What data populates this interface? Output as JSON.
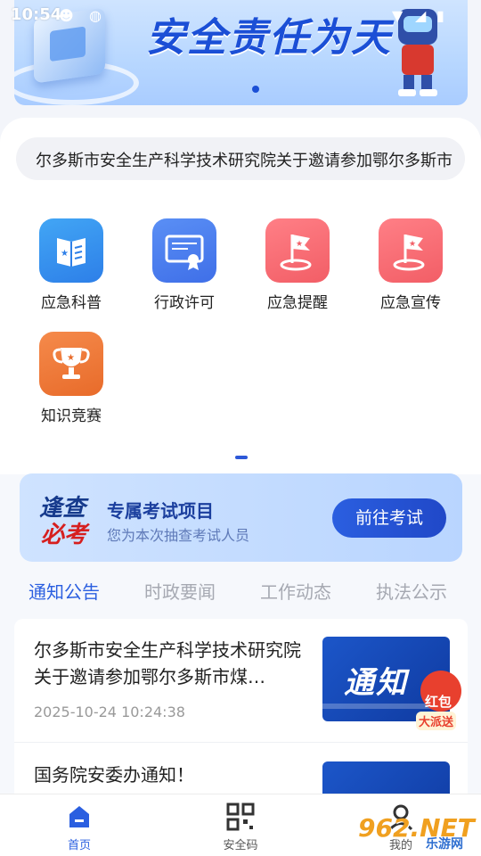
{
  "status_bar": {
    "time": "10:54"
  },
  "banner": {
    "title": "安全责任为天"
  },
  "notice_marquee": "尔多斯市安全生产科学技术研究院关于邀请参加鄂尔多斯市",
  "quick_actions": [
    {
      "label": "应急科普",
      "icon": "book-icon",
      "color": "#3a93f0"
    },
    {
      "label": "行政许可",
      "icon": "certificate-icon",
      "color": "#4a7ff0"
    },
    {
      "label": "应急提醒",
      "icon": "flag-location-icon",
      "color": "#f56a72"
    },
    {
      "label": "应急宣传",
      "icon": "flag-location-icon",
      "color": "#f56a72"
    },
    {
      "label": "知识竞赛",
      "icon": "trophy-icon",
      "color": "#ef7a38"
    }
  ],
  "exam_card": {
    "logo_line1": "逢查",
    "logo_line2": "必考",
    "title": "专属考试项目",
    "subtitle": "您为本次抽查考试人员",
    "button": "前往考试"
  },
  "tabs": [
    "通知公告",
    "时政要闻",
    "工作动态",
    "执法公示"
  ],
  "news": [
    {
      "title": "尔多斯市安全生产科学技术研究院关于邀请参加鄂尔多斯市煤…",
      "time": "2025-10-24 10:24:38",
      "thumb_text": "通知"
    },
    {
      "title": "国务院安委办通知！",
      "time": "",
      "thumb_text": ""
    }
  ],
  "floating_badge": {
    "line1": "红包",
    "line2": "大派送"
  },
  "bottom_nav": [
    {
      "label": "首页",
      "icon": "home-icon"
    },
    {
      "label": "安全码",
      "icon": "qr-code-icon"
    },
    {
      "label": "我的",
      "icon": "user-icon"
    }
  ],
  "watermark": {
    "main": "962.NET",
    "sub": "乐游网"
  }
}
